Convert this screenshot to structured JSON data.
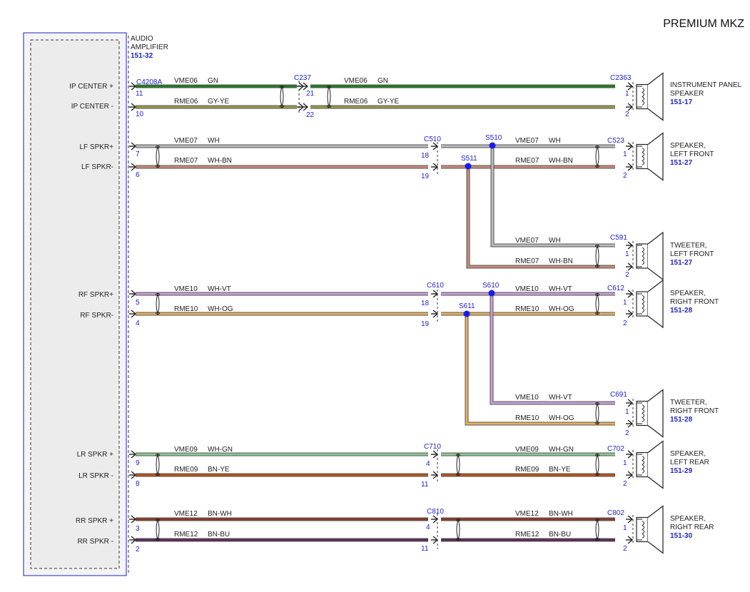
{
  "title": "PREMIUM MKZ",
  "amplifier": {
    "name_line1": "AUDIO",
    "name_line2": "AMPLIFIER",
    "ref": "151-32",
    "connector": "C4208A",
    "pins": [
      {
        "label": "IP CENTER +",
        "pin": "11"
      },
      {
        "label": "IP CENTER -",
        "pin": "10"
      },
      {
        "label": "LF SPKR+",
        "pin": "7"
      },
      {
        "label": "LF SPKR-",
        "pin": "6"
      },
      {
        "label": "RF SPKR+",
        "pin": "5"
      },
      {
        "label": "RF SPKR-",
        "pin": "4"
      },
      {
        "label": "LR SPKR +",
        "pin": "9"
      },
      {
        "label": "LR SPKR -",
        "pin": "8"
      },
      {
        "label": "RR SPKR +",
        "pin": "3"
      },
      {
        "label": "RR SPKR -",
        "pin": "2"
      }
    ]
  },
  "inline_connectors": [
    {
      "name": "C237",
      "pins": [
        "21",
        "22"
      ]
    },
    {
      "name": "C510",
      "pins": [
        "18",
        "19"
      ]
    },
    {
      "name": "C610",
      "pins": [
        "18",
        "19"
      ]
    },
    {
      "name": "C710",
      "pins": [
        "4",
        "11"
      ]
    },
    {
      "name": "C810",
      "pins": [
        "4",
        "11"
      ]
    }
  ],
  "splices": [
    "S510",
    "S511",
    "S610",
    "S611"
  ],
  "speakers": [
    {
      "name_line1": "INSTRUMENT PANEL",
      "name_line2": "SPEAKER",
      "ref": "151-17",
      "connector": "C2363",
      "pins": [
        "1",
        "2"
      ]
    },
    {
      "name_line1": "SPEAKER,",
      "name_line2": "LEFT FRONT",
      "ref": "151-27",
      "connector": "C523",
      "pins": [
        "1",
        "2"
      ]
    },
    {
      "name_line1": "TWEETER,",
      "name_line2": "LEFT FRONT",
      "ref": "151-27",
      "connector": "C591",
      "pins": [
        "1",
        "2"
      ]
    },
    {
      "name_line1": "SPEAKER,",
      "name_line2": "RIGHT FRONT",
      "ref": "151-28",
      "connector": "C612",
      "pins": [
        "1",
        "2"
      ]
    },
    {
      "name_line1": "TWEETER,",
      "name_line2": "RIGHT FRONT",
      "ref": "151-28",
      "connector": "C691",
      "pins": [
        "1",
        "2"
      ]
    },
    {
      "name_line1": "SPEAKER,",
      "name_line2": "LEFT REAR",
      "ref": "151-29",
      "connector": "C702",
      "pins": [
        "1",
        "2"
      ]
    },
    {
      "name_line1": "SPEAKER,",
      "name_line2": "RIGHT REAR",
      "ref": "151-30",
      "connector": "C802",
      "pins": [
        "1",
        "2"
      ]
    }
  ],
  "circuits": [
    {
      "circuit": "VME06",
      "color_code": "GN"
    },
    {
      "circuit": "RME06",
      "color_code": "GY-YE"
    },
    {
      "circuit": "VME07",
      "color_code": "WH"
    },
    {
      "circuit": "RME07",
      "color_code": "WH-BN"
    },
    {
      "circuit": "VME10",
      "color_code": "WH-VT"
    },
    {
      "circuit": "RME10",
      "color_code": "WH-OG"
    },
    {
      "circuit": "VME09",
      "color_code": "WH-GN"
    },
    {
      "circuit": "RME09",
      "color_code": "BN-YE"
    },
    {
      "circuit": "VME12",
      "color_code": "BN-WH"
    },
    {
      "circuit": "RME12",
      "color_code": "BN-BU"
    }
  ],
  "colors": {
    "label_blue": "#2222cc",
    "module_border": "#4444cc",
    "GN": "#1e7d1e",
    "GY-YE": "#9a9a4a",
    "WH": "#bbbbbb",
    "WH-BN": "#c98a7a",
    "WH-VT": "#c9a0d8",
    "WH-OG": "#e8b060",
    "WH-GN": "#8ec98e",
    "BN-YE": "#b8541a",
    "BN-WH": "#8a3a2a",
    "BN-BU": "#5a2a5a",
    "splice": "#1a1aee"
  }
}
